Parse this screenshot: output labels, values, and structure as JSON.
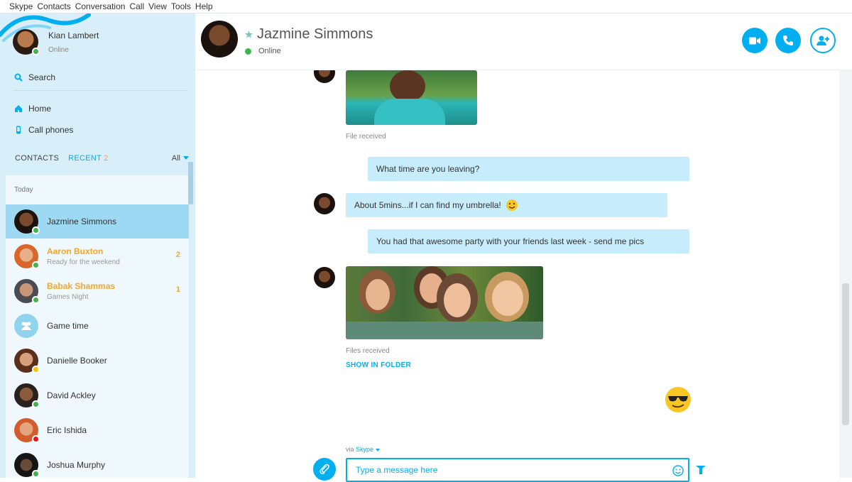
{
  "menu": [
    "Skype",
    "Contacts",
    "Conversation",
    "Call",
    "View",
    "Tools",
    "Help"
  ],
  "me": {
    "name": "Kian Lambert",
    "status": "Online"
  },
  "nav": {
    "search": "Search",
    "home": "Home",
    "call_phones": "Call phones"
  },
  "tabs": {
    "contacts": "CONTACTS",
    "recent": "RECENT",
    "recent_count": "2",
    "filter": "All"
  },
  "section_today": "Today",
  "contacts": [
    {
      "name": "Jazmine Simmons",
      "sub": "",
      "badge": "",
      "presence": "online",
      "selected": true,
      "unread": false
    },
    {
      "name": "Aaron Buxton",
      "sub": "Ready for the weekend",
      "badge": "2",
      "presence": "online",
      "selected": false,
      "unread": true
    },
    {
      "name": "Babak Shammas",
      "sub": "Games Night",
      "badge": "1",
      "presence": "online",
      "selected": false,
      "unread": true
    },
    {
      "name": "Game time",
      "sub": "",
      "badge": "",
      "presence": "",
      "selected": false,
      "unread": false
    },
    {
      "name": "Danielle Booker",
      "sub": "",
      "badge": "",
      "presence": "away",
      "selected": false,
      "unread": false
    },
    {
      "name": "David Ackley",
      "sub": "",
      "badge": "",
      "presence": "online",
      "selected": false,
      "unread": false
    },
    {
      "name": "Eric Ishida",
      "sub": "",
      "badge": "",
      "presence": "busy",
      "selected": false,
      "unread": false
    },
    {
      "name": "Joshua Murphy",
      "sub": "",
      "badge": "",
      "presence": "online",
      "selected": false,
      "unread": false
    }
  ],
  "header": {
    "name": "Jazmine Simmons",
    "status": "Online"
  },
  "messages": {
    "file_received": "File received",
    "m1": "What time are you leaving?",
    "m2": "About 5mins...if I can find my umbrella!",
    "m3": "You had that awesome party with your friends last week - send me pics",
    "files_received": "Files received",
    "show_in_folder": "SHOW IN FOLDER"
  },
  "compose": {
    "via_prefix": "via",
    "via_service": "Skype",
    "placeholder": "Type a message here"
  },
  "colors": {
    "accent": "#00aff0",
    "sidebar": "#d8eef9",
    "bubble": "#c7edfc",
    "unread": "#f6a623",
    "online": "#3fb54a"
  }
}
